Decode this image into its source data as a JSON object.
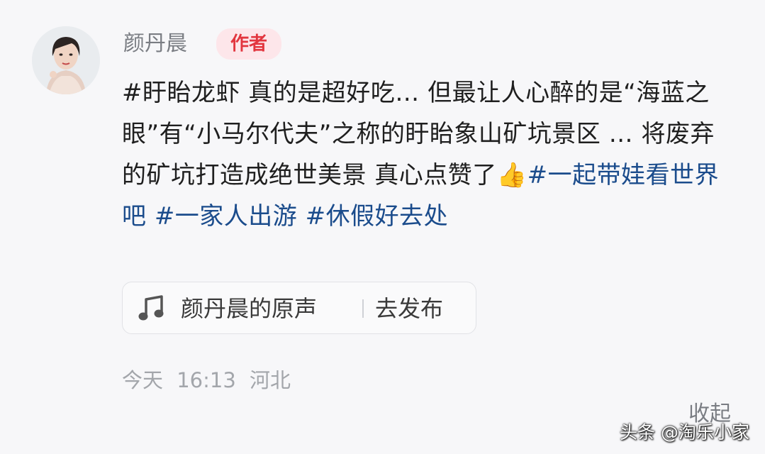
{
  "comment": {
    "username": "颜丹晨",
    "author_badge": "作者",
    "text_lead": "#盱眙龙虾 真的是超好吃… 但最让人心醉的是“海蓝之眼”有“小马尔代夫”之称的盱眙象山矿坑景区 … 将废弃的矿坑打造成绝世美景 真心点赞了",
    "emoji": "👍",
    "hashtags": [
      "#一起带娃看世界吧",
      "#一家人出游",
      "#休假好去处"
    ],
    "music": {
      "icon": "music-note-icon",
      "label": "颜丹晨的原声",
      "action": "去发布"
    },
    "meta": {
      "date": "今天",
      "time": "16:13",
      "location": "河北"
    },
    "collapse_label": "收起"
  },
  "watermark": "头条 @淘乐小家",
  "colors": {
    "background": "#f7f7f9",
    "hashtag": "#1b4c8c",
    "badge_bg": "#fde6ea",
    "badge_text": "#e2363f",
    "muted": "#a3a6ab"
  }
}
